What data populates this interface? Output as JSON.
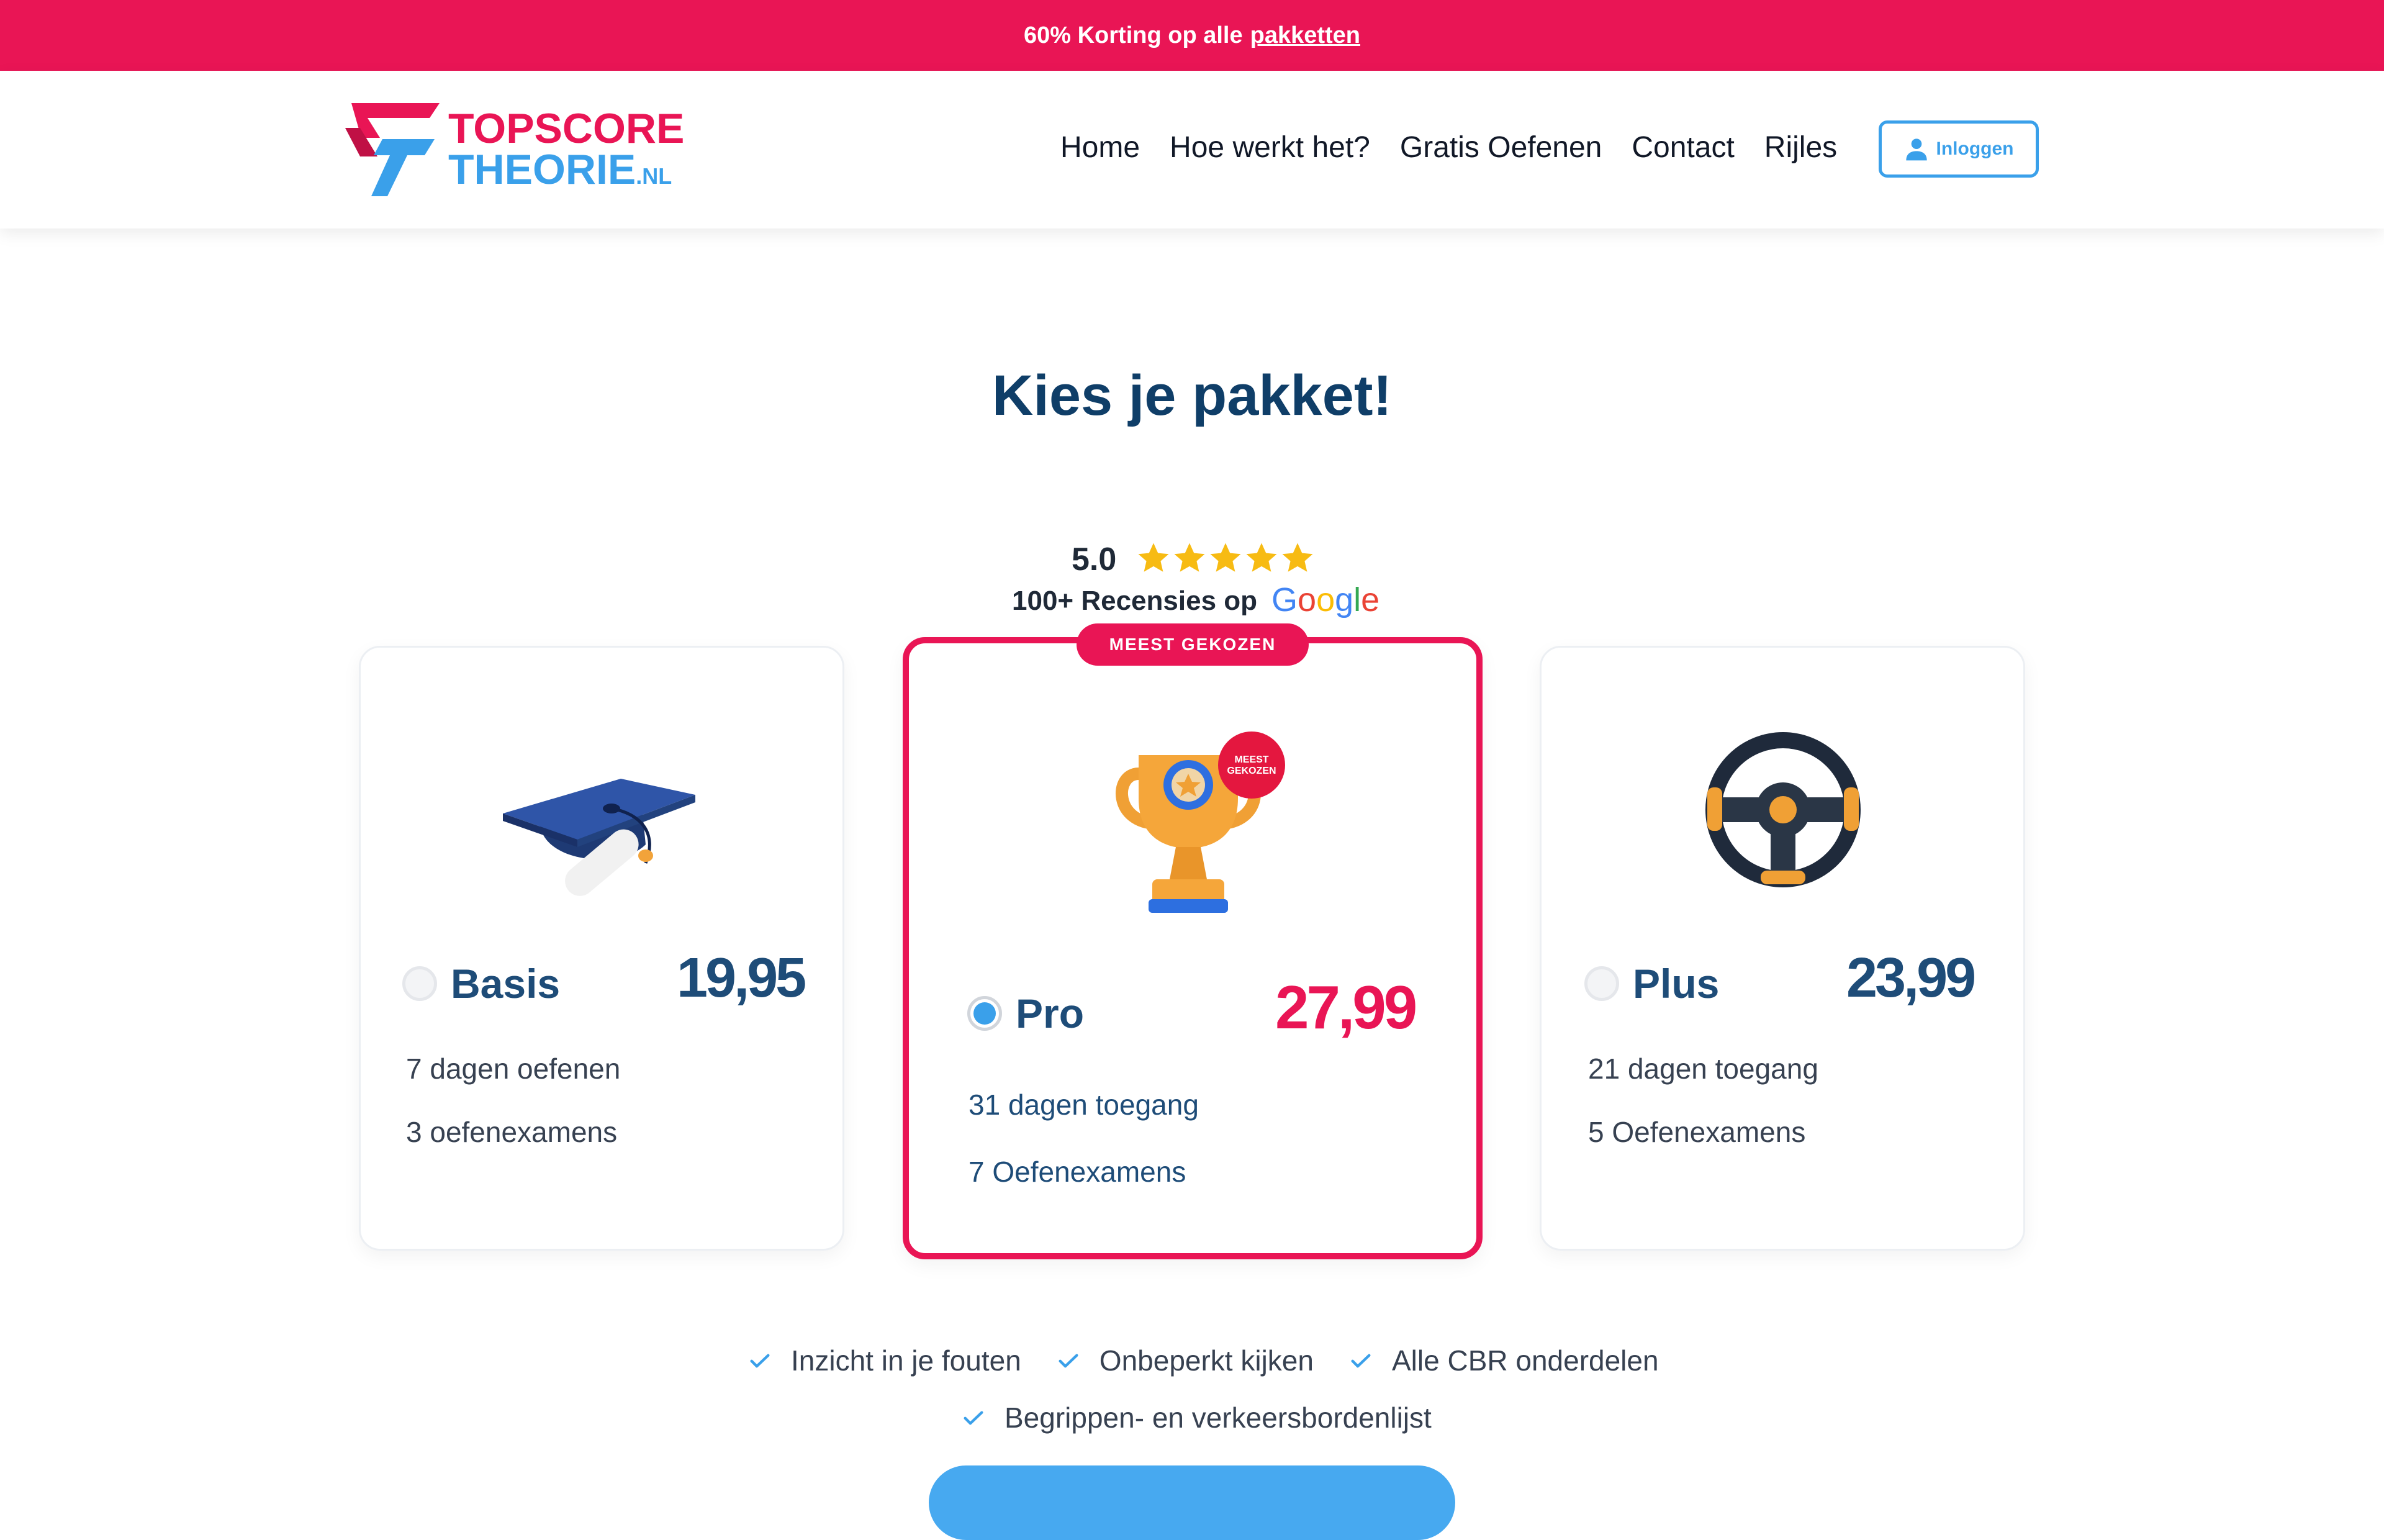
{
  "promo": {
    "text": "60% Korting op alle",
    "link": "pakketten"
  },
  "logo": {
    "line1": "TOPSCORE",
    "line2": "THEORIE",
    "tld": ".NL"
  },
  "nav": {
    "items": [
      "Home",
      "Hoe werkt het?",
      "Gratis Oefenen",
      "Contact",
      "Rijles"
    ],
    "login": "Inloggen"
  },
  "title": "Kies je pakket!",
  "rating": {
    "score": "5.0",
    "stars": 5,
    "text": "100+ Recensies op",
    "brand": "Google"
  },
  "badge": "MEEST GEKOZEN",
  "trophy_badge": [
    "MEEST",
    "GEKOZEN"
  ],
  "plans": [
    {
      "name": "Basis",
      "price": "19,95",
      "features": [
        "7 dagen oefenen",
        "3 oefenexamens"
      ],
      "selected": false,
      "icon": "graduation-cap-icon"
    },
    {
      "name": "Pro",
      "price": "27,99",
      "features": [
        "31 dagen toegang",
        "7 Oefenexamens"
      ],
      "selected": true,
      "icon": "trophy-icon"
    },
    {
      "name": "Plus",
      "price": "23,99",
      "features": [
        "21 dagen toegang",
        "5 Oefenexamens"
      ],
      "selected": false,
      "icon": "steering-wheel-icon"
    }
  ],
  "benefits": [
    "Inzicht in je fouten",
    "Onbeperkt kijken",
    "Alle CBR onderdelen",
    "Begrippen- en verkeersbordenlijst"
  ],
  "colors": {
    "brand_pink": "#e91555",
    "brand_blue": "#3aa0ea",
    "navy": "#0f3e68",
    "plan_text": "#1e4c78"
  }
}
